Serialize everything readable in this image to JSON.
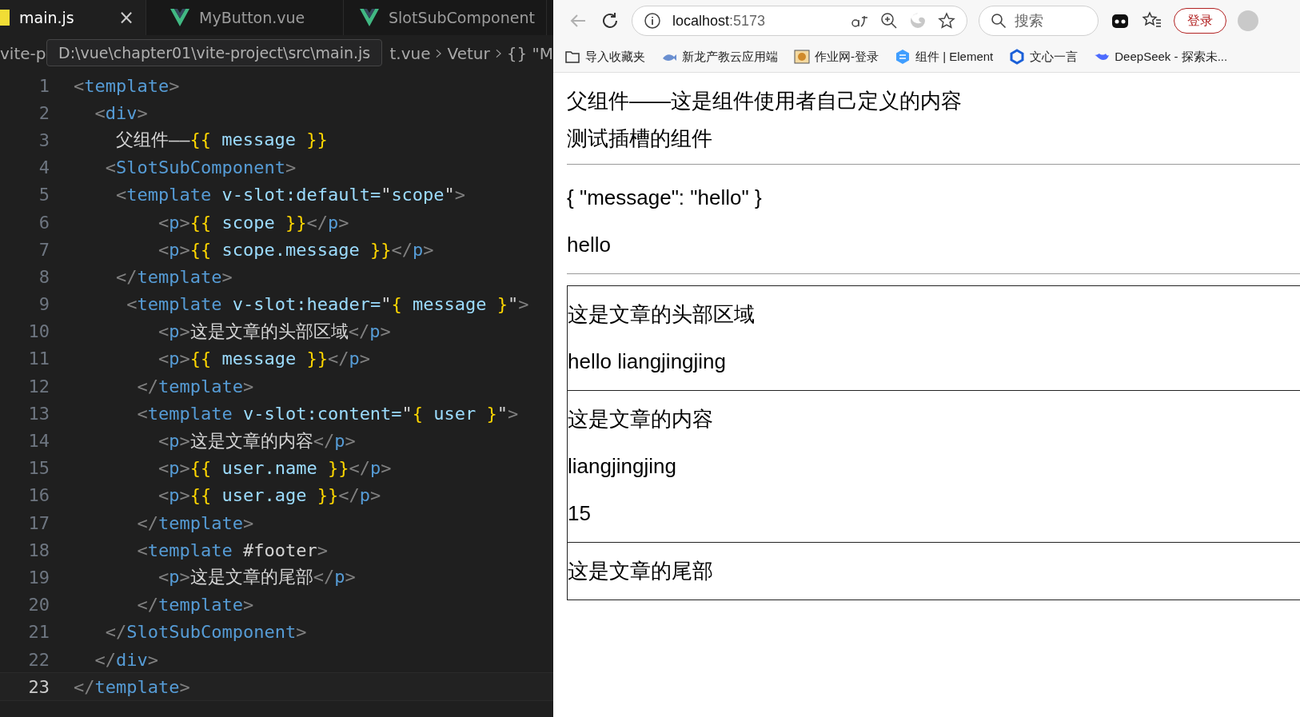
{
  "editor": {
    "tabs": [
      {
        "label": "main.js",
        "selected": true,
        "close": "×"
      },
      {
        "label": "MyButton.vue",
        "selected": false
      },
      {
        "label": "SlotSubComponent",
        "selected": false
      }
    ],
    "breadcrumb": {
      "lead": "vite-p",
      "tail": [
        "t.vue",
        "Vetur",
        "{} \"M"
      ]
    },
    "tooltip": "D:\\vue\\chapter01\\vite-project\\src\\main.js",
    "lines": [
      {
        "n": "1",
        "selected": false,
        "tokens": [
          {
            "kind": "p",
            "t": "<"
          },
          {
            "kind": "tag",
            "t": "template"
          },
          {
            "kind": "p",
            "t": ">"
          }
        ]
      },
      {
        "n": "2",
        "selected": false,
        "tokens": [
          {
            "kind": "p",
            "t": "  <"
          },
          {
            "kind": "tag",
            "t": "div"
          },
          {
            "kind": "p",
            "t": ">"
          }
        ]
      },
      {
        "n": "3",
        "selected": false,
        "tokens": [
          {
            "kind": "text",
            "t": "    父组件——"
          },
          {
            "kind": "brace",
            "t": "{{"
          },
          {
            "kind": "var",
            "t": " message "
          },
          {
            "kind": "brace",
            "t": "}}"
          }
        ]
      },
      {
        "n": "4",
        "selected": false,
        "tokens": [
          {
            "kind": "p",
            "t": "   <"
          },
          {
            "kind": "tag",
            "t": "SlotSubComponent"
          },
          {
            "kind": "p",
            "t": ">"
          }
        ]
      },
      {
        "n": "5",
        "selected": false,
        "tokens": [
          {
            "kind": "p",
            "t": "    <"
          },
          {
            "kind": "tag",
            "t": "template"
          },
          {
            "kind": "attr",
            "t": " v-slot:default="
          },
          {
            "kind": "text",
            "t": "\""
          },
          {
            "kind": "var",
            "t": "scope"
          },
          {
            "kind": "text",
            "t": "\""
          },
          {
            "kind": "p",
            "t": ">"
          }
        ]
      },
      {
        "n": "6",
        "selected": false,
        "tokens": [
          {
            "kind": "p",
            "t": "        <"
          },
          {
            "kind": "tag",
            "t": "p"
          },
          {
            "kind": "p",
            "t": ">"
          },
          {
            "kind": "brace",
            "t": "{{"
          },
          {
            "kind": "var",
            "t": " scope "
          },
          {
            "kind": "brace",
            "t": "}}"
          },
          {
            "kind": "p",
            "t": "</"
          },
          {
            "kind": "tag",
            "t": "p"
          },
          {
            "kind": "p",
            "t": ">"
          }
        ]
      },
      {
        "n": "7",
        "selected": false,
        "tokens": [
          {
            "kind": "p",
            "t": "        <"
          },
          {
            "kind": "tag",
            "t": "p"
          },
          {
            "kind": "p",
            "t": ">"
          },
          {
            "kind": "brace",
            "t": "{{"
          },
          {
            "kind": "var",
            "t": " scope.message "
          },
          {
            "kind": "brace",
            "t": "}}"
          },
          {
            "kind": "p",
            "t": "</"
          },
          {
            "kind": "tag",
            "t": "p"
          },
          {
            "kind": "p",
            "t": ">"
          }
        ]
      },
      {
        "n": "8",
        "selected": false,
        "tokens": [
          {
            "kind": "p",
            "t": "    </"
          },
          {
            "kind": "tag",
            "t": "template"
          },
          {
            "kind": "p",
            "t": ">"
          }
        ]
      },
      {
        "n": "9",
        "selected": false,
        "tokens": [
          {
            "kind": "p",
            "t": "     <"
          },
          {
            "kind": "tag",
            "t": "template"
          },
          {
            "kind": "attr",
            "t": " v-slot:header="
          },
          {
            "kind": "text",
            "t": "\""
          },
          {
            "kind": "brace",
            "t": "{"
          },
          {
            "kind": "var",
            "t": " message "
          },
          {
            "kind": "brace",
            "t": "}"
          },
          {
            "kind": "text",
            "t": "\""
          },
          {
            "kind": "p",
            "t": ">"
          }
        ]
      },
      {
        "n": "10",
        "selected": false,
        "tokens": [
          {
            "kind": "p",
            "t": "        <"
          },
          {
            "kind": "tag",
            "t": "p"
          },
          {
            "kind": "p",
            "t": ">"
          },
          {
            "kind": "text",
            "t": "这是文章的头部区域"
          },
          {
            "kind": "p",
            "t": "</"
          },
          {
            "kind": "tag",
            "t": "p"
          },
          {
            "kind": "p",
            "t": ">"
          }
        ]
      },
      {
        "n": "11",
        "selected": false,
        "tokens": [
          {
            "kind": "p",
            "t": "        <"
          },
          {
            "kind": "tag",
            "t": "p"
          },
          {
            "kind": "p",
            "t": ">"
          },
          {
            "kind": "brace",
            "t": "{{"
          },
          {
            "kind": "var",
            "t": " message "
          },
          {
            "kind": "brace",
            "t": "}}"
          },
          {
            "kind": "p",
            "t": "</"
          },
          {
            "kind": "tag",
            "t": "p"
          },
          {
            "kind": "p",
            "t": ">"
          }
        ]
      },
      {
        "n": "12",
        "selected": false,
        "tokens": [
          {
            "kind": "p",
            "t": "      </"
          },
          {
            "kind": "tag",
            "t": "template"
          },
          {
            "kind": "p",
            "t": ">"
          }
        ]
      },
      {
        "n": "13",
        "selected": false,
        "tokens": [
          {
            "kind": "p",
            "t": "      <"
          },
          {
            "kind": "tag",
            "t": "template"
          },
          {
            "kind": "attr",
            "t": " v-slot:content="
          },
          {
            "kind": "text",
            "t": "\""
          },
          {
            "kind": "brace",
            "t": "{"
          },
          {
            "kind": "var",
            "t": " user "
          },
          {
            "kind": "brace",
            "t": "}"
          },
          {
            "kind": "text",
            "t": "\""
          },
          {
            "kind": "p",
            "t": ">"
          }
        ]
      },
      {
        "n": "14",
        "selected": false,
        "tokens": [
          {
            "kind": "p",
            "t": "        <"
          },
          {
            "kind": "tag",
            "t": "p"
          },
          {
            "kind": "p",
            "t": ">"
          },
          {
            "kind": "text",
            "t": "这是文章的内容"
          },
          {
            "kind": "p",
            "t": "</"
          },
          {
            "kind": "tag",
            "t": "p"
          },
          {
            "kind": "p",
            "t": ">"
          }
        ]
      },
      {
        "n": "15",
        "selected": false,
        "tokens": [
          {
            "kind": "p",
            "t": "        <"
          },
          {
            "kind": "tag",
            "t": "p"
          },
          {
            "kind": "p",
            "t": ">"
          },
          {
            "kind": "brace",
            "t": "{{"
          },
          {
            "kind": "var",
            "t": " user.name "
          },
          {
            "kind": "brace",
            "t": "}}"
          },
          {
            "kind": "p",
            "t": "</"
          },
          {
            "kind": "tag",
            "t": "p"
          },
          {
            "kind": "p",
            "t": ">"
          }
        ]
      },
      {
        "n": "16",
        "selected": false,
        "tokens": [
          {
            "kind": "p",
            "t": "        <"
          },
          {
            "kind": "tag",
            "t": "p"
          },
          {
            "kind": "p",
            "t": ">"
          },
          {
            "kind": "brace",
            "t": "{{"
          },
          {
            "kind": "var",
            "t": " user.age "
          },
          {
            "kind": "brace",
            "t": "}}"
          },
          {
            "kind": "p",
            "t": "</"
          },
          {
            "kind": "tag",
            "t": "p"
          },
          {
            "kind": "p",
            "t": ">"
          }
        ]
      },
      {
        "n": "17",
        "selected": false,
        "tokens": [
          {
            "kind": "p",
            "t": "      </"
          },
          {
            "kind": "tag",
            "t": "template"
          },
          {
            "kind": "p",
            "t": ">"
          }
        ]
      },
      {
        "n": "18",
        "selected": false,
        "tokens": [
          {
            "kind": "p",
            "t": "      <"
          },
          {
            "kind": "tag",
            "t": "template"
          },
          {
            "kind": "text",
            "t": " #footer"
          },
          {
            "kind": "p",
            "t": ">"
          }
        ]
      },
      {
        "n": "19",
        "selected": false,
        "tokens": [
          {
            "kind": "p",
            "t": "        <"
          },
          {
            "kind": "tag",
            "t": "p"
          },
          {
            "kind": "p",
            "t": ">"
          },
          {
            "kind": "text",
            "t": "这是文章的尾部"
          },
          {
            "kind": "p",
            "t": "</"
          },
          {
            "kind": "tag",
            "t": "p"
          },
          {
            "kind": "p",
            "t": ">"
          }
        ]
      },
      {
        "n": "20",
        "selected": false,
        "tokens": [
          {
            "kind": "p",
            "t": "      </"
          },
          {
            "kind": "tag",
            "t": "template"
          },
          {
            "kind": "p",
            "t": ">"
          }
        ]
      },
      {
        "n": "21",
        "selected": false,
        "tokens": [
          {
            "kind": "p",
            "t": "   </"
          },
          {
            "kind": "tag",
            "t": "SlotSubComponent"
          },
          {
            "kind": "p",
            "t": ">"
          }
        ]
      },
      {
        "n": "22",
        "selected": false,
        "tokens": [
          {
            "kind": "p",
            "t": "  </"
          },
          {
            "kind": "tag",
            "t": "div"
          },
          {
            "kind": "p",
            "t": ">"
          }
        ]
      },
      {
        "n": "23",
        "selected": true,
        "tokens": [
          {
            "kind": "p",
            "t": "</"
          },
          {
            "kind": "tag",
            "t": "template"
          },
          {
            "kind": "p",
            "t": ">"
          }
        ]
      }
    ]
  },
  "browser": {
    "address": {
      "host": "localhost",
      "port": ":5173"
    },
    "search": {
      "placeholder": "搜索"
    },
    "login": "登录",
    "bookmarks": [
      {
        "label": "导入收藏夹"
      },
      {
        "label": "新龙产教云应用端"
      },
      {
        "label": "作业网-登录"
      },
      {
        "label": "组件 | Element"
      },
      {
        "label": "文心一言"
      },
      {
        "label": "DeepSeek - 探索未..."
      }
    ],
    "page": [
      {
        "kind": "p",
        "text": "父组件——这是组件使用者自己定义的内容"
      },
      {
        "kind": "line",
        "text": "测试插槽的组件"
      },
      {
        "kind": "hr"
      },
      {
        "kind": "p",
        "text": "{ \"message\": \"hello\" }"
      },
      {
        "kind": "p",
        "text": "hello"
      },
      {
        "kind": "hr"
      },
      {
        "kind": "box",
        "sections": [
          [
            "这是文章的头部区域",
            "hello liangjingjing"
          ],
          [
            "这是文章的内容",
            "liangjingjing",
            "15"
          ],
          [
            "这是文章的尾部"
          ]
        ]
      }
    ]
  }
}
